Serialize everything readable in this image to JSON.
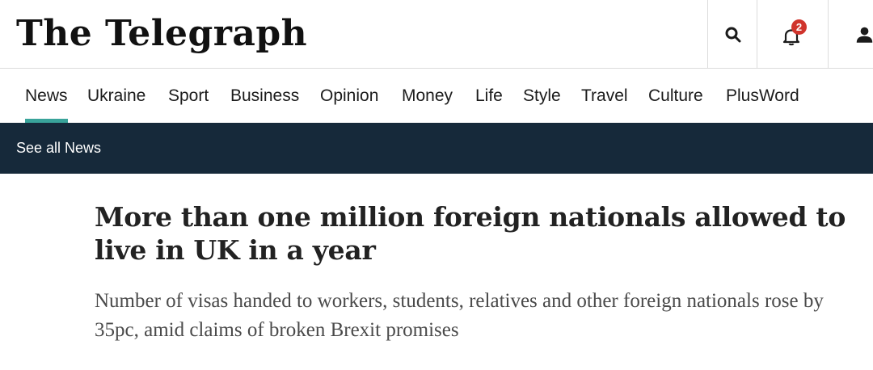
{
  "header": {
    "logo": "The Telegraph",
    "notification_count": "2"
  },
  "nav": {
    "items": [
      {
        "label": "News",
        "active": true
      },
      {
        "label": "Ukraine"
      },
      {
        "label": "Sport"
      },
      {
        "label": "Business"
      },
      {
        "label": "Opinion"
      },
      {
        "label": "Money"
      },
      {
        "label": "Life"
      },
      {
        "label": "Style"
      },
      {
        "label": "Travel"
      },
      {
        "label": "Culture"
      },
      {
        "label": "PlusWord"
      }
    ]
  },
  "subnav": {
    "link": "See all News"
  },
  "article": {
    "headline": "More than one million foreign nationals allowed to live in UK in a year",
    "standfirst": "Number of visas handed to workers, students, relatives and other foreign nationals rose by 35pc, amid claims of broken Brexit promises"
  },
  "colors": {
    "accent": "#39a39a",
    "subnav_bg": "#16293a",
    "badge": "#d0342c"
  }
}
